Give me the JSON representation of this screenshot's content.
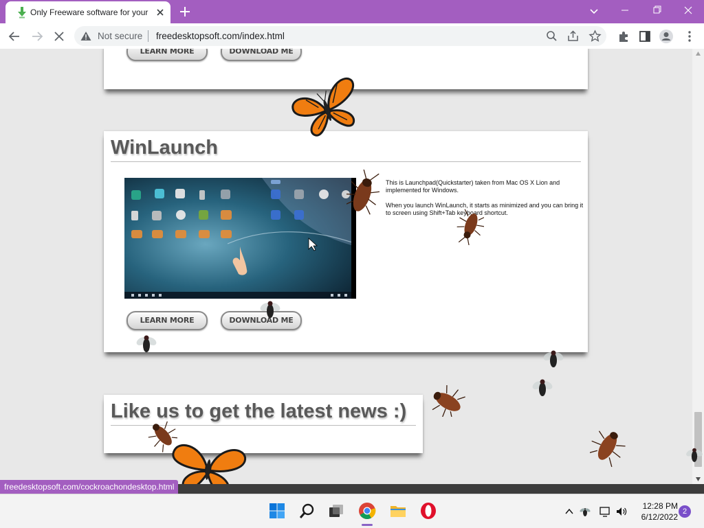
{
  "browser": {
    "tab_title": "Only Freeware software for your",
    "security_label": "Not secure",
    "url": "freedesktopsoft.com/index.html",
    "status_link": "freedesktopsoft.com/cockroachondesktop.html",
    "theme_color": "#a35ec0"
  },
  "page": {
    "top_card": {
      "learn_more": "LEARN MORE",
      "download": "DOWNLOAD ME"
    },
    "winlaunch": {
      "title": "WinLaunch",
      "description": [
        "This is Launchpad(Quickstarter) taken from Mac OS X Lion and implemented for Windows.",
        "When you launch WinLaunch, it starts as minimized and you can bring it to screen using Shift+Tab keyboard shortcut."
      ],
      "learn_more": "LEARN MORE",
      "download": "DOWNLOAD ME"
    },
    "social": {
      "title": "Like us to get the latest news :)"
    }
  },
  "taskbar": {
    "apps": [
      "start-icon",
      "search-icon",
      "task-view-icon",
      "chrome-icon",
      "file-explorer-icon",
      "opera-icon"
    ],
    "time": "12:28 PM",
    "date": "6/12/2022",
    "notification_count": "2"
  }
}
